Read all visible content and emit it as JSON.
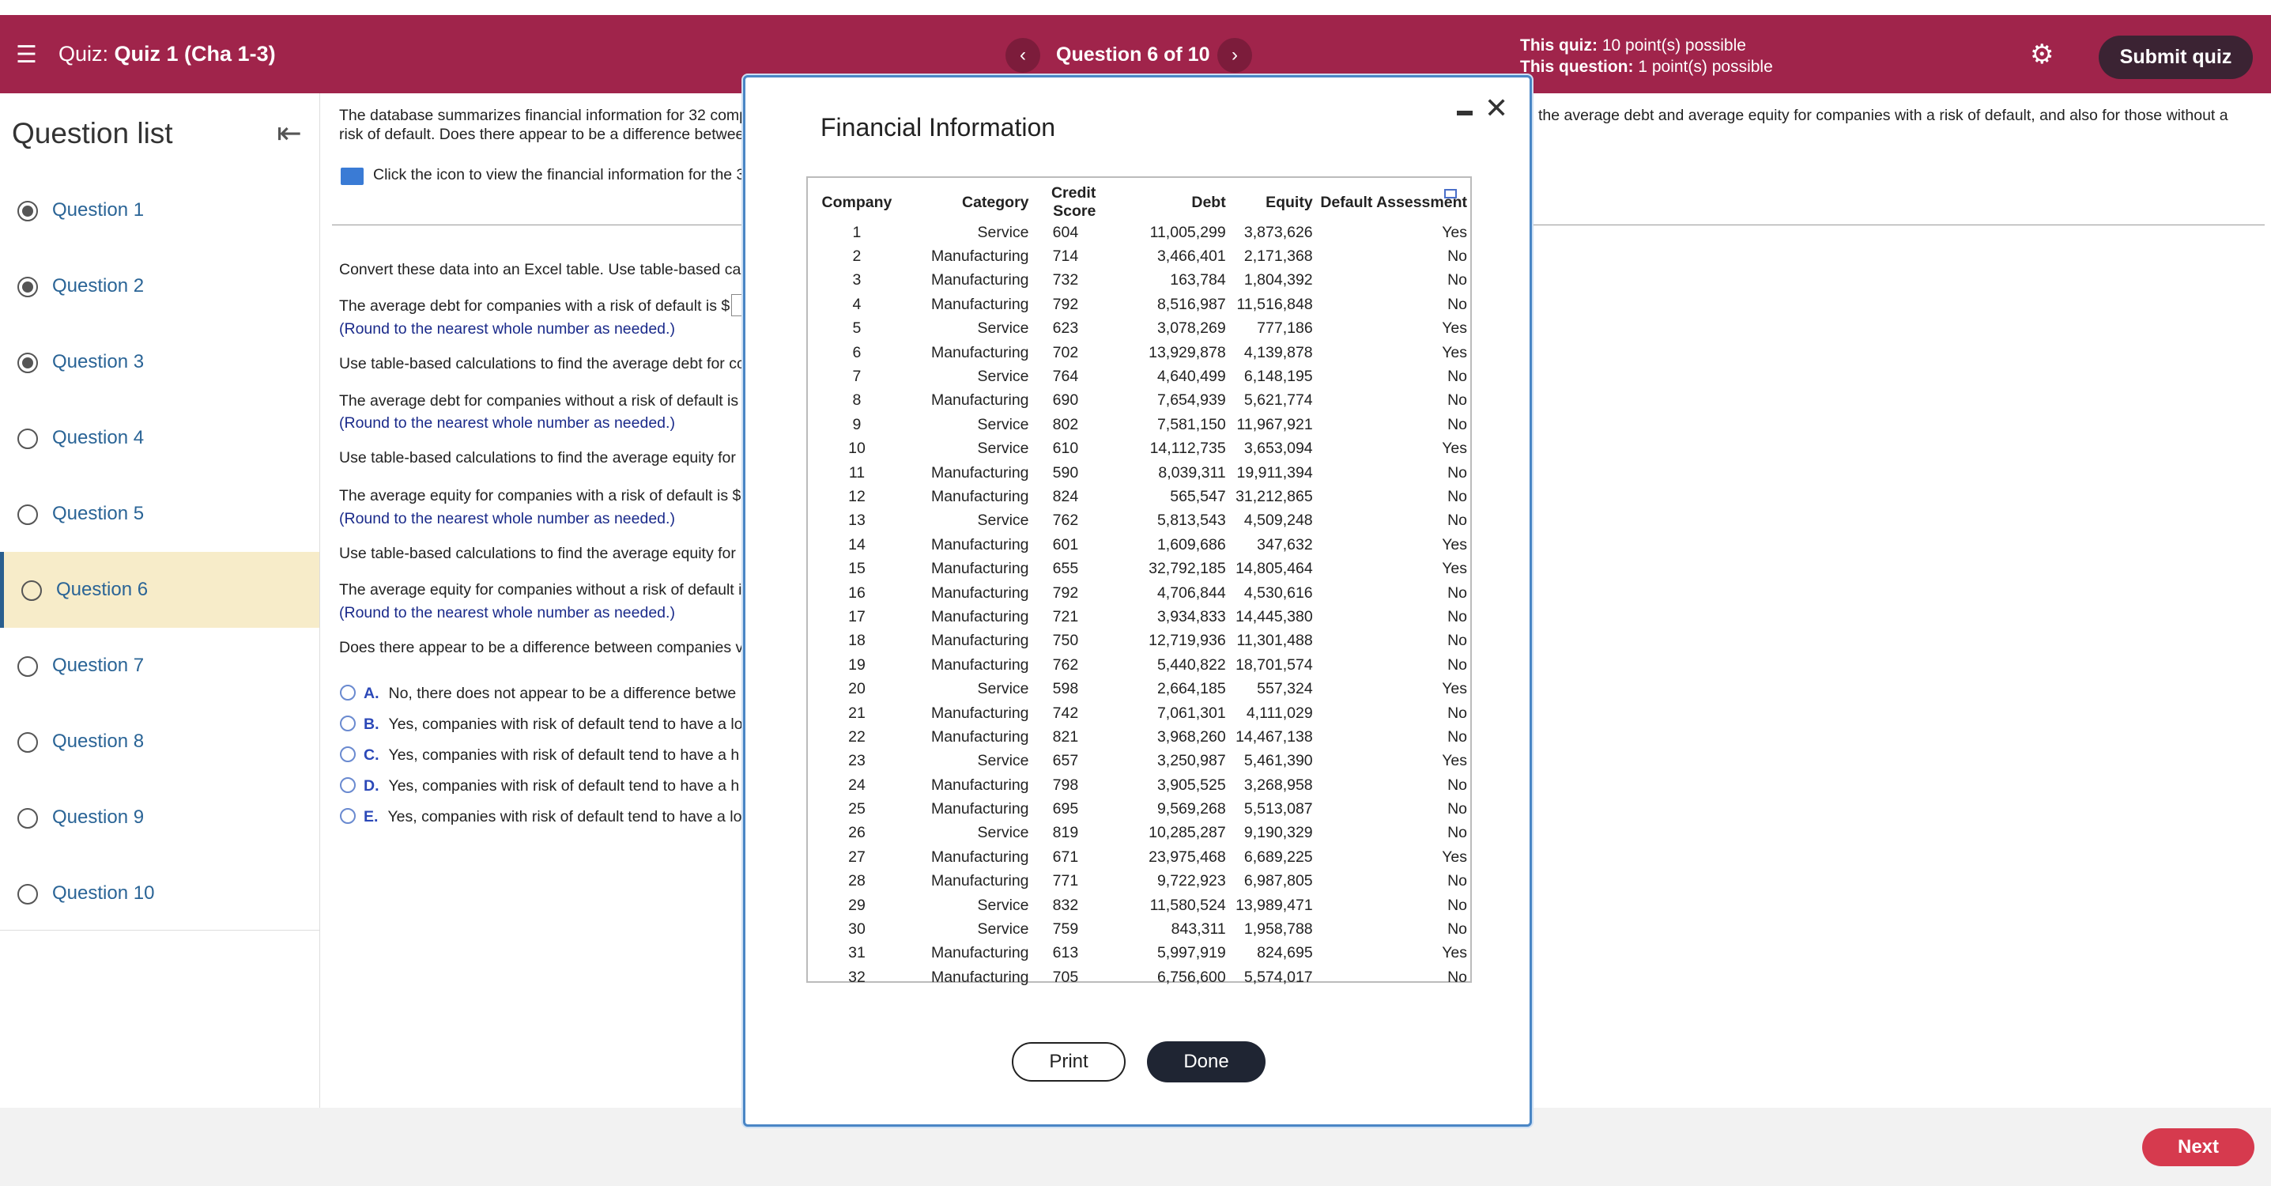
{
  "header": {
    "menu_icon": "hamburger-icon",
    "quiz_prefix": "Quiz:",
    "quiz_name": "Quiz 1 (Cha 1-3)",
    "prev_icon": "chevron-left-icon",
    "next_icon": "chevron-right-icon",
    "question_counter": "Question 6 of 10",
    "quiz_points_label": "This quiz:",
    "quiz_points": "10 point(s) possible",
    "question_points_label": "This question:",
    "question_points": "1 point(s) possible",
    "settings_icon": "gear-icon",
    "submit_label": "Submit quiz",
    "brand_color": "#a0244b"
  },
  "sidebar": {
    "title": "Question list",
    "collapse_icon": "collapse-left-icon",
    "items": [
      {
        "label": "Question 1",
        "status": "answered"
      },
      {
        "label": "Question 2",
        "status": "answered"
      },
      {
        "label": "Question 3",
        "status": "answered"
      },
      {
        "label": "Question 4",
        "status": "unanswered"
      },
      {
        "label": "Question 5",
        "status": "unanswered"
      },
      {
        "label": "Question 6",
        "status": "current"
      },
      {
        "label": "Question 7",
        "status": "unanswered"
      },
      {
        "label": "Question 8",
        "status": "unanswered"
      },
      {
        "label": "Question 9",
        "status": "unanswered"
      },
      {
        "label": "Question 10",
        "status": "unanswered"
      }
    ]
  },
  "question": {
    "intro_line1": "The database summarizes financial information for 32 comp",
    "intro_line2": "risk of default. Does there appear to be a difference betwee",
    "intro_right": "the average debt and average equity for companies with a risk of default, and also for those without a",
    "icon_hint": "Click the icon to view the financial information for the 3",
    "convert": "Convert these data into an Excel table. Use table-based ca",
    "q1": "The average debt for companies with a risk of default is $",
    "round1": "(Round to the nearest whole number as needed.)",
    "calc2": "Use table-based calculations to find the average debt for cc",
    "q2": "The average debt for companies without a risk of default is",
    "round2": "(Round to the nearest whole number as needed.)",
    "calc3": "Use table-based calculations to find the average equity for",
    "q3": "The average equity for companies with a risk of default is $",
    "round3": "(Round to the nearest whole number as needed.)",
    "calc4": "Use table-based calculations to find the average equity for",
    "q4": "The average equity for companies without a risk of default i",
    "round4": "(Round to the nearest whole number as needed.)",
    "q5": "Does there appear to be a difference between companies v",
    "options": [
      {
        "letter": "A.",
        "text": "No, there does not appear to be a difference betwe"
      },
      {
        "letter": "B.",
        "text": "Yes, companies with risk of default tend to have a lo"
      },
      {
        "letter": "C.",
        "text": "Yes, companies with risk of default tend to have a h"
      },
      {
        "letter": "D.",
        "text": "Yes, companies with risk of default tend to have a h"
      },
      {
        "letter": "E.",
        "text": "Yes, companies with risk of default tend to have a lo"
      }
    ]
  },
  "modal": {
    "title": "Financial Information",
    "minimize_icon": "minimize-icon",
    "close_icon": "close-icon",
    "copy_icon": "copy-icon",
    "print_label": "Print",
    "done_label": "Done",
    "columns": [
      "Company",
      "Category",
      "Credit Score",
      "Debt",
      "Equity",
      "Default Assessment"
    ],
    "rows": [
      [
        "1",
        "Service",
        "604",
        "11,005,299",
        "3,873,626",
        "Yes"
      ],
      [
        "2",
        "Manufacturing",
        "714",
        "3,466,401",
        "2,171,368",
        "No"
      ],
      [
        "3",
        "Manufacturing",
        "732",
        "163,784",
        "1,804,392",
        "No"
      ],
      [
        "4",
        "Manufacturing",
        "792",
        "8,516,987",
        "11,516,848",
        "No"
      ],
      [
        "5",
        "Service",
        "623",
        "3,078,269",
        "777,186",
        "Yes"
      ],
      [
        "6",
        "Manufacturing",
        "702",
        "13,929,878",
        "4,139,878",
        "Yes"
      ],
      [
        "7",
        "Service",
        "764",
        "4,640,499",
        "6,148,195",
        "No"
      ],
      [
        "8",
        "Manufacturing",
        "690",
        "7,654,939",
        "5,621,774",
        "No"
      ],
      [
        "9",
        "Service",
        "802",
        "7,581,150",
        "11,967,921",
        "No"
      ],
      [
        "10",
        "Service",
        "610",
        "14,112,735",
        "3,653,094",
        "Yes"
      ],
      [
        "11",
        "Manufacturing",
        "590",
        "8,039,311",
        "19,911,394",
        "No"
      ],
      [
        "12",
        "Manufacturing",
        "824",
        "565,547",
        "31,212,865",
        "No"
      ],
      [
        "13",
        "Service",
        "762",
        "5,813,543",
        "4,509,248",
        "No"
      ],
      [
        "14",
        "Manufacturing",
        "601",
        "1,609,686",
        "347,632",
        "Yes"
      ],
      [
        "15",
        "Manufacturing",
        "655",
        "32,792,185",
        "14,805,464",
        "Yes"
      ],
      [
        "16",
        "Manufacturing",
        "792",
        "4,706,844",
        "4,530,616",
        "No"
      ],
      [
        "17",
        "Manufacturing",
        "721",
        "3,934,833",
        "14,445,380",
        "No"
      ],
      [
        "18",
        "Manufacturing",
        "750",
        "12,719,936",
        "11,301,488",
        "No"
      ],
      [
        "19",
        "Manufacturing",
        "762",
        "5,440,822",
        "18,701,574",
        "No"
      ],
      [
        "20",
        "Service",
        "598",
        "2,664,185",
        "557,324",
        "Yes"
      ],
      [
        "21",
        "Manufacturing",
        "742",
        "7,061,301",
        "4,111,029",
        "No"
      ],
      [
        "22",
        "Manufacturing",
        "821",
        "3,968,260",
        "14,467,138",
        "No"
      ],
      [
        "23",
        "Service",
        "657",
        "3,250,987",
        "5,461,390",
        "Yes"
      ],
      [
        "24",
        "Manufacturing",
        "798",
        "3,905,525",
        "3,268,958",
        "No"
      ],
      [
        "25",
        "Manufacturing",
        "695",
        "9,569,268",
        "5,513,087",
        "No"
      ],
      [
        "26",
        "Service",
        "819",
        "10,285,287",
        "9,190,329",
        "No"
      ],
      [
        "27",
        "Manufacturing",
        "671",
        "23,975,468",
        "6,689,225",
        "Yes"
      ],
      [
        "28",
        "Manufacturing",
        "771",
        "9,722,923",
        "6,987,805",
        "No"
      ],
      [
        "29",
        "Service",
        "832",
        "11,580,524",
        "13,989,471",
        "No"
      ],
      [
        "30",
        "Service",
        "759",
        "843,311",
        "1,958,788",
        "No"
      ],
      [
        "31",
        "Manufacturing",
        "613",
        "5,997,919",
        "824,695",
        "Yes"
      ],
      [
        "32",
        "Manufacturing",
        "705",
        "6,756,600",
        "5,574,017",
        "No"
      ]
    ]
  },
  "footer": {
    "next_label": "Next"
  }
}
